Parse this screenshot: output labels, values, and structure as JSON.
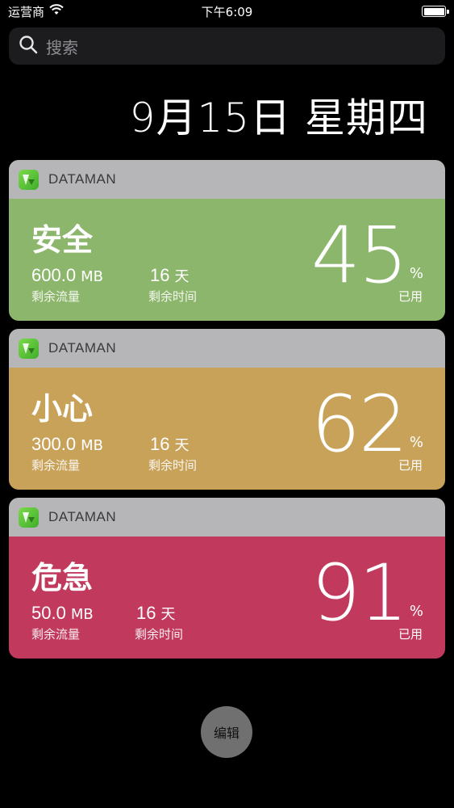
{
  "status_bar": {
    "carrier": "运营商",
    "time": "下午6:09"
  },
  "search": {
    "placeholder": "搜索"
  },
  "date": "9月15日 星期四",
  "colors": {
    "safe": "#8cb66b",
    "caution": "#c9a25a",
    "danger": "#c13a5e",
    "header": "#b6b6b8"
  },
  "widgets": [
    {
      "app_name": "DATAMAN",
      "status": "安全",
      "remaining_data": "600.0",
      "data_unit": "MB",
      "remaining_data_label": "剩余流量",
      "remaining_days": "16",
      "days_unit": "天",
      "remaining_time_label": "剩余时间",
      "used_percent": "45",
      "percent_sign": "%",
      "used_label": "已用"
    },
    {
      "app_name": "DATAMAN",
      "status": "小心",
      "remaining_data": "300.0",
      "data_unit": "MB",
      "remaining_data_label": "剩余流量",
      "remaining_days": "16",
      "days_unit": "天",
      "remaining_time_label": "剩余时间",
      "used_percent": "62",
      "percent_sign": "%",
      "used_label": "已用"
    },
    {
      "app_name": "DATAMAN",
      "status": "危急",
      "remaining_data": "50.0",
      "data_unit": "MB",
      "remaining_data_label": "剩余流量",
      "remaining_days": "16",
      "days_unit": "天",
      "remaining_time_label": "剩余时间",
      "used_percent": "91",
      "percent_sign": "%",
      "used_label": "已用"
    }
  ],
  "edit_button": {
    "label": "编辑"
  }
}
